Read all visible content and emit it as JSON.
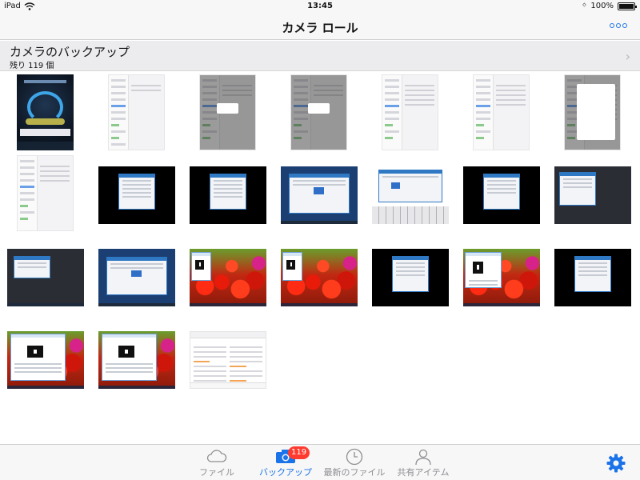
{
  "status": {
    "device": "iPad",
    "time": "13:45",
    "battery": "100%",
    "battery_level": 1.0
  },
  "nav": {
    "title": "カメラ ロール"
  },
  "banner": {
    "title": "カメラのバックアップ",
    "subtitle": "残り 119 個"
  },
  "tabs": [
    {
      "label": "ファイル"
    },
    {
      "label": "バックアップ",
      "badge": "119"
    },
    {
      "label": "最新のファイル"
    },
    {
      "label": "共有アイテム"
    }
  ],
  "colors": {
    "accent": "#1a73e8",
    "badge": "#ff3b30"
  }
}
